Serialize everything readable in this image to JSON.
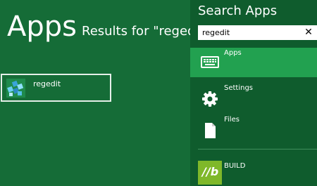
{
  "page": {
    "title": "Apps",
    "results_text": "Results for \"regedit\""
  },
  "results": [
    {
      "label": "regedit",
      "icon": "registry-editor-icon"
    }
  ],
  "search": {
    "title": "Search Apps",
    "query": "regedit",
    "clear_icon": "close-icon",
    "clear_glyph": "✕"
  },
  "scopes": [
    {
      "label": "Apps",
      "icon": "apps-keyboard-icon",
      "selected": true
    },
    {
      "label": "Settings",
      "icon": "gear-icon",
      "selected": false
    },
    {
      "label": "Files",
      "icon": "file-icon",
      "selected": false
    },
    {
      "label": "BUILD",
      "icon": "build-app-icon",
      "icon_text": "//b",
      "selected": false
    }
  ],
  "colors": {
    "background": "#156c37",
    "pane": "#0f5c2d",
    "selected_scope": "#22a150",
    "build_tile": "#7fb82a"
  }
}
